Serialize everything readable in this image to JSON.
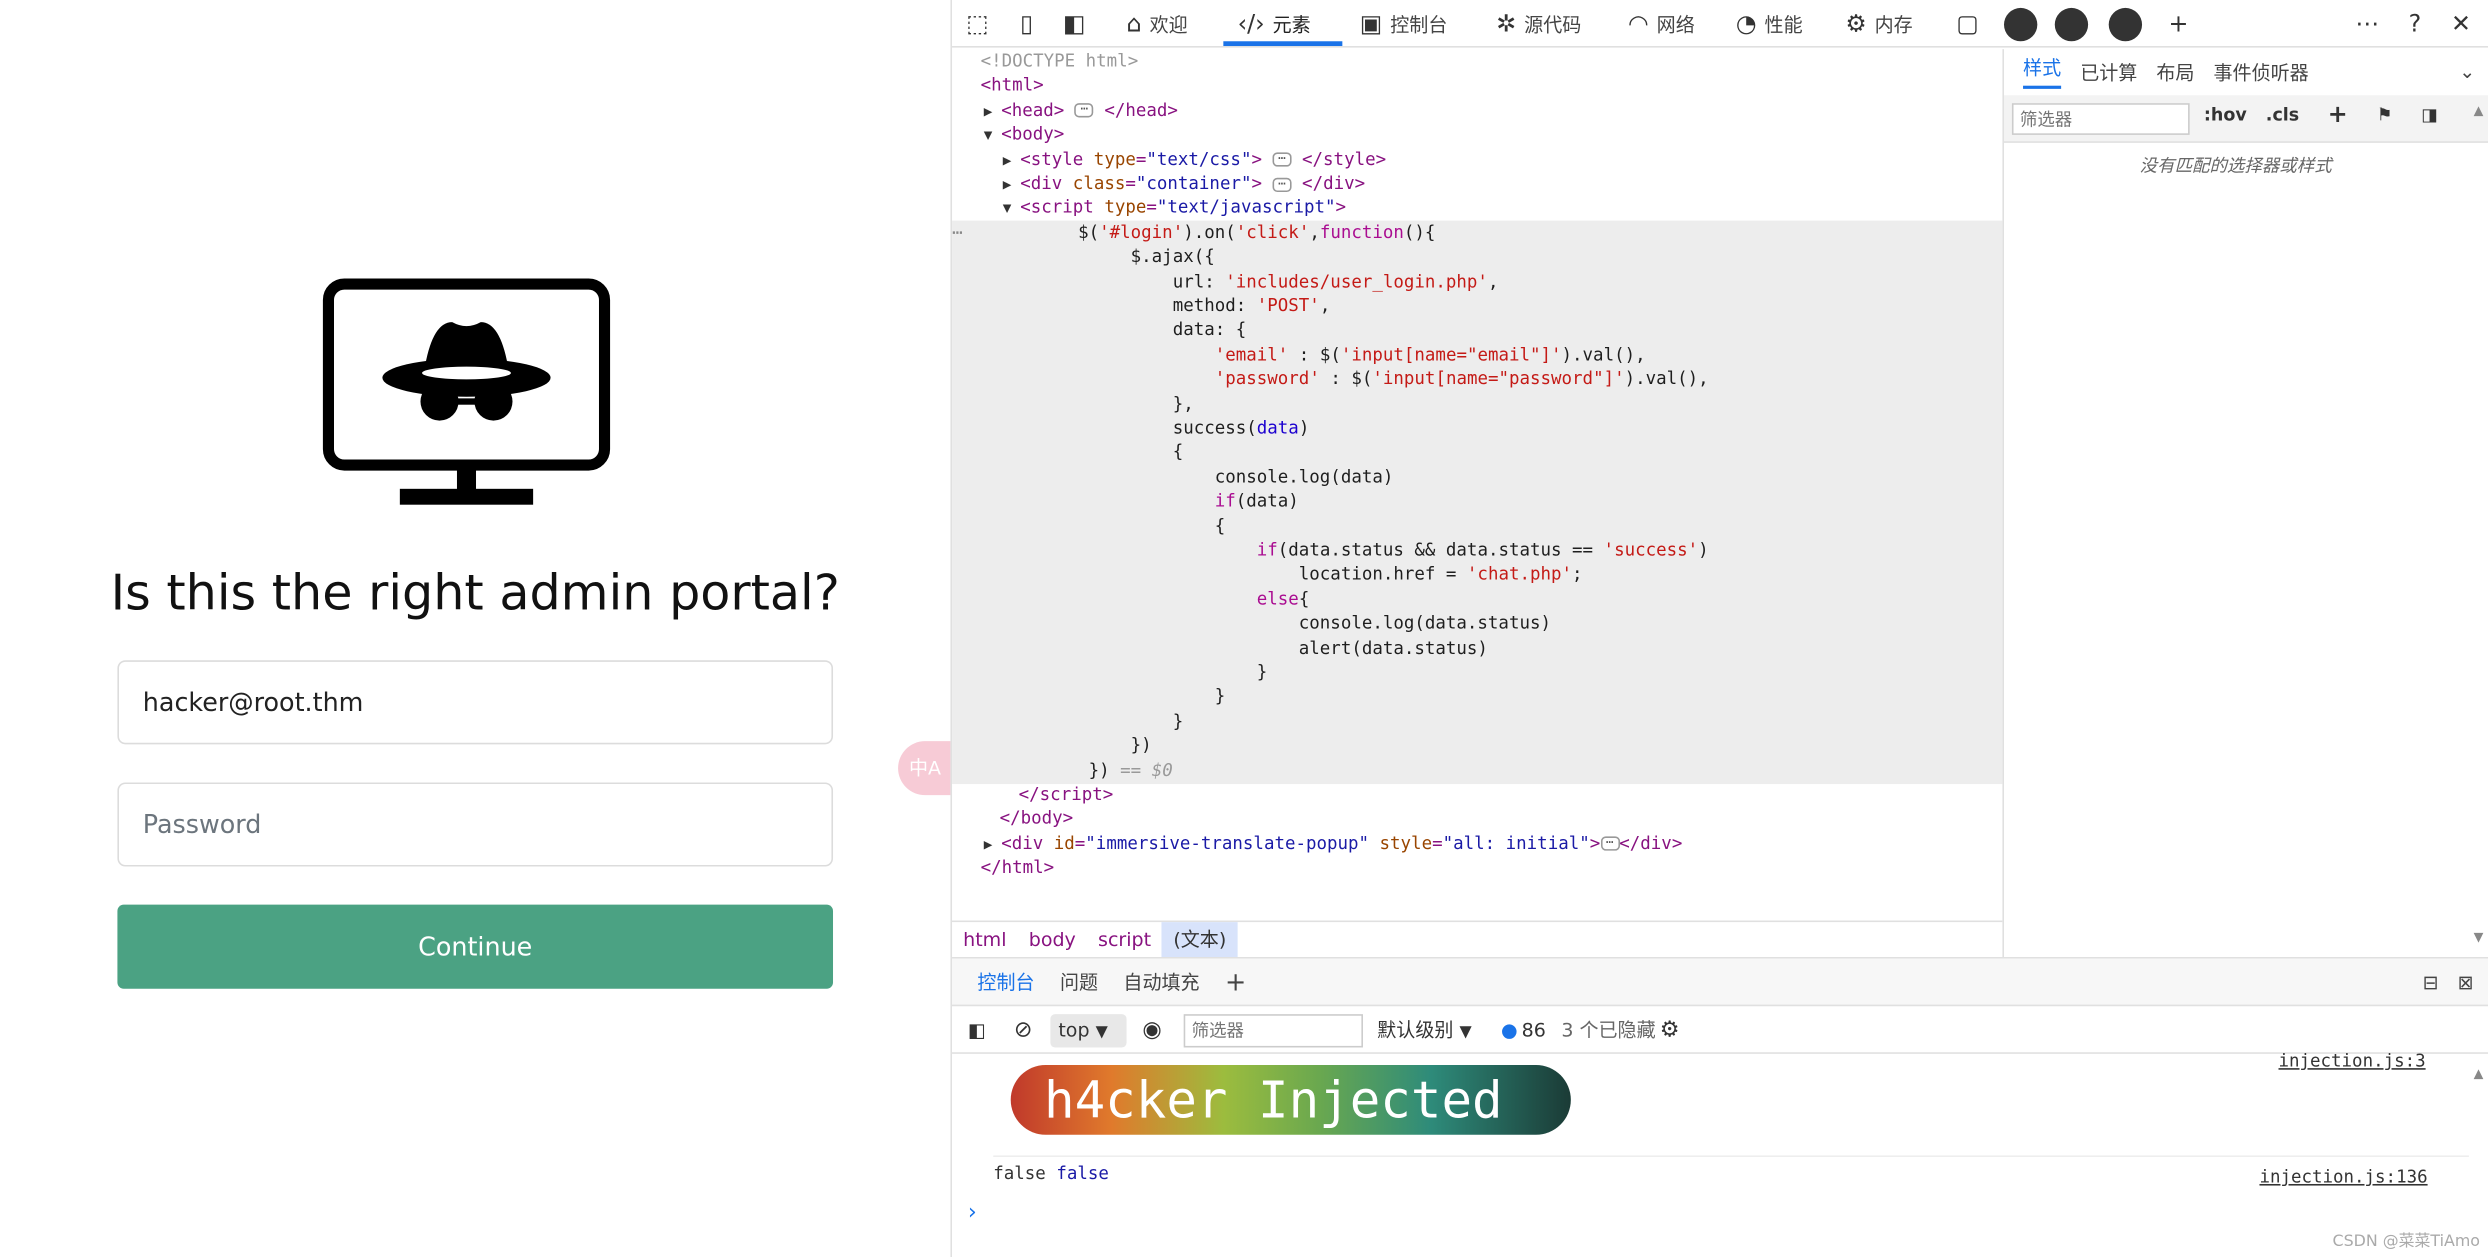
{
  "login": {
    "heading": "Is this the right admin portal?",
    "email_value": "hacker@root.thm",
    "password_placeholder": "Password",
    "continue_label": "Continue",
    "translate_badge": "中A"
  },
  "devtools": {
    "tabs": [
      {
        "label": "欢迎",
        "icon": "home-icon"
      },
      {
        "label": "元素",
        "icon": "code-icon"
      },
      {
        "label": "控制台",
        "icon": "console-icon"
      },
      {
        "label": "源代码",
        "icon": "bug-icon"
      },
      {
        "label": "网络",
        "icon": "wifi-icon"
      },
      {
        "label": "性能",
        "icon": "gauge-icon"
      },
      {
        "label": "内存",
        "icon": "gear-icon"
      }
    ],
    "active_tab": "元素",
    "breadcrumb": [
      "html",
      "body",
      "script",
      "(文本)"
    ],
    "styles_tabs": [
      "样式",
      "已计算",
      "布局",
      "事件侦听器"
    ],
    "styles_filter_placeholder": "筛选器",
    "hov": ":hov",
    "cls": ".cls",
    "no_match": "没有匹配的选择器或样式",
    "console_tabs": [
      "控制台",
      "问题",
      "自动填充"
    ],
    "console": {
      "context": "top",
      "filter_placeholder": "筛选器",
      "level": "默认级别",
      "message_count": "86",
      "hidden": "3 个已隐藏",
      "banner": "h4cker Injected",
      "link1": "injection.js:3",
      "link2": "injection.js:136",
      "log_a": "false",
      "log_b": "false"
    },
    "watermark": "CSDN @菜菜TiAmo"
  }
}
